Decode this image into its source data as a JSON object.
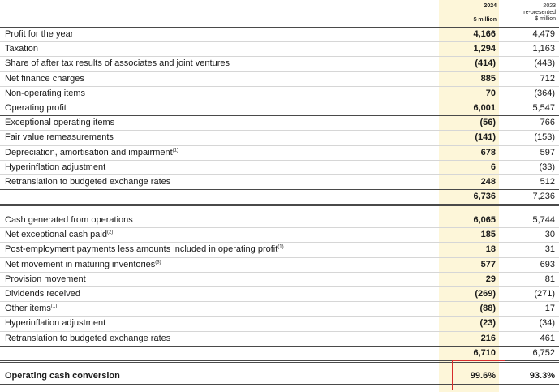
{
  "header": {
    "col_2024": {
      "year": "2024",
      "unit": "$ million"
    },
    "col_2023": {
      "year": "2023",
      "note": "re-presented",
      "unit": "$ million"
    }
  },
  "section1": {
    "rows": [
      {
        "label": "Profit for the year",
        "v2024": "4,166",
        "v2023": "4,479"
      },
      {
        "label": "Taxation",
        "v2024": "1,294",
        "v2023": "1,163"
      },
      {
        "label": "Share of after tax results of associates and joint ventures",
        "v2024": "(414)",
        "v2023": "(443)"
      },
      {
        "label": "Net finance charges",
        "v2024": "885",
        "v2023": "712"
      },
      {
        "label": "Non-operating items",
        "v2024": "70",
        "v2023": "(364)"
      },
      {
        "label": "Operating profit",
        "v2024": "6,001",
        "v2023": "5,547"
      },
      {
        "label": "Exceptional operating items",
        "v2024": "(56)",
        "v2023": "766"
      },
      {
        "label": "Fair value remeasurements",
        "v2024": "(141)",
        "v2023": "(153)"
      },
      {
        "label": "Depreciation, amortisation and impairment",
        "sup": "(1)",
        "v2024": "678",
        "v2023": "597"
      },
      {
        "label": "Hyperinflation adjustment",
        "v2024": "6",
        "v2023": "(33)"
      },
      {
        "label": "Retranslation to budgeted exchange rates",
        "v2024": "248",
        "v2023": "512"
      }
    ],
    "total": {
      "v2024": "6,736",
      "v2023": "7,236"
    }
  },
  "section2": {
    "rows": [
      {
        "label": "Cash generated from operations",
        "v2024": "6,065",
        "v2023": "5,744"
      },
      {
        "label": "Net exceptional cash paid",
        "sup": "(2)",
        "v2024": "185",
        "v2023": "30"
      },
      {
        "label": "Post-employment payments less amounts included in operating profit",
        "sup": "(1)",
        "v2024": "18",
        "v2023": "31"
      },
      {
        "label": "Net movement in maturing inventories",
        "sup": "(3)",
        "v2024": "577",
        "v2023": "693"
      },
      {
        "label": "Provision movement",
        "v2024": "29",
        "v2023": "81"
      },
      {
        "label": "Dividends received",
        "v2024": "(269)",
        "v2023": "(271)"
      },
      {
        "label": "Other items",
        "sup": "(1)",
        "v2024": "(88)",
        "v2023": "17"
      },
      {
        "label": "Hyperinflation adjustment",
        "v2024": "(23)",
        "v2023": "(34)"
      },
      {
        "label": "Retranslation to budgeted exchange rates",
        "v2024": "216",
        "v2023": "461"
      }
    ],
    "total": {
      "v2024": "6,710",
      "v2023": "6,752"
    }
  },
  "conversion": {
    "label": "Operating cash conversion",
    "v2024": "99.6%",
    "v2023": "93.3%"
  },
  "colors": {
    "highlight_column": "#fdf6d9",
    "annotation_box": "#d62b2b"
  }
}
